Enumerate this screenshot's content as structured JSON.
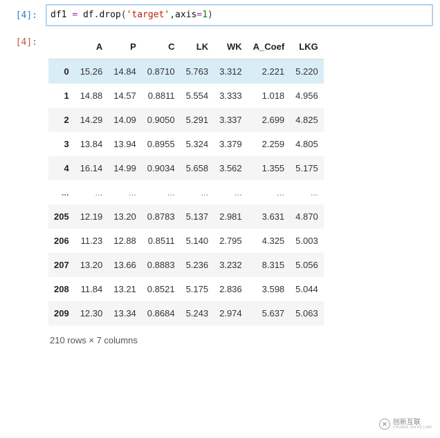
{
  "input_prompt": "[4]:",
  "output_prompt": "[4]:",
  "code": {
    "lhs": "df1",
    "eq": "=",
    "obj": "df",
    "dot": ".",
    "method": "drop",
    "open": "(",
    "arg_str_q1": "'",
    "arg_str": "target",
    "arg_str_q2": "'",
    "comma": ",",
    "kwarg": "axis",
    "eq2": "=",
    "kwval": "1",
    "close": ")"
  },
  "columns": [
    "A",
    "P",
    "C",
    "LK",
    "WK",
    "A_Coef",
    "LKG"
  ],
  "rows": [
    {
      "idx": "0",
      "v": [
        "15.26",
        "14.84",
        "0.8710",
        "5.763",
        "3.312",
        "2.221",
        "5.220"
      ]
    },
    {
      "idx": "1",
      "v": [
        "14.88",
        "14.57",
        "0.8811",
        "5.554",
        "3.333",
        "1.018",
        "4.956"
      ]
    },
    {
      "idx": "2",
      "v": [
        "14.29",
        "14.09",
        "0.9050",
        "5.291",
        "3.337",
        "2.699",
        "4.825"
      ]
    },
    {
      "idx": "3",
      "v": [
        "13.84",
        "13.94",
        "0.8955",
        "5.324",
        "3.379",
        "2.259",
        "4.805"
      ]
    },
    {
      "idx": "4",
      "v": [
        "16.14",
        "14.99",
        "0.9034",
        "5.658",
        "3.562",
        "1.355",
        "5.175"
      ]
    },
    {
      "idx": "...",
      "v": [
        "...",
        "...",
        "...",
        "...",
        "...",
        "...",
        "..."
      ]
    },
    {
      "idx": "205",
      "v": [
        "12.19",
        "13.20",
        "0.8783",
        "5.137",
        "2.981",
        "3.631",
        "4.870"
      ]
    },
    {
      "idx": "206",
      "v": [
        "11.23",
        "12.88",
        "0.8511",
        "5.140",
        "2.795",
        "4.325",
        "5.003"
      ]
    },
    {
      "idx": "207",
      "v": [
        "13.20",
        "13.66",
        "0.8883",
        "5.236",
        "3.232",
        "8.315",
        "5.056"
      ]
    },
    {
      "idx": "208",
      "v": [
        "11.84",
        "13.21",
        "0.8521",
        "5.175",
        "2.836",
        "3.598",
        "5.044"
      ]
    },
    {
      "idx": "209",
      "v": [
        "12.30",
        "13.34",
        "0.8684",
        "5.243",
        "2.974",
        "5.637",
        "5.063"
      ]
    }
  ],
  "caption": "210 rows × 7 columns",
  "watermark": {
    "zh": "创新互联",
    "en": "CHUANG XIN HU LIAN"
  }
}
